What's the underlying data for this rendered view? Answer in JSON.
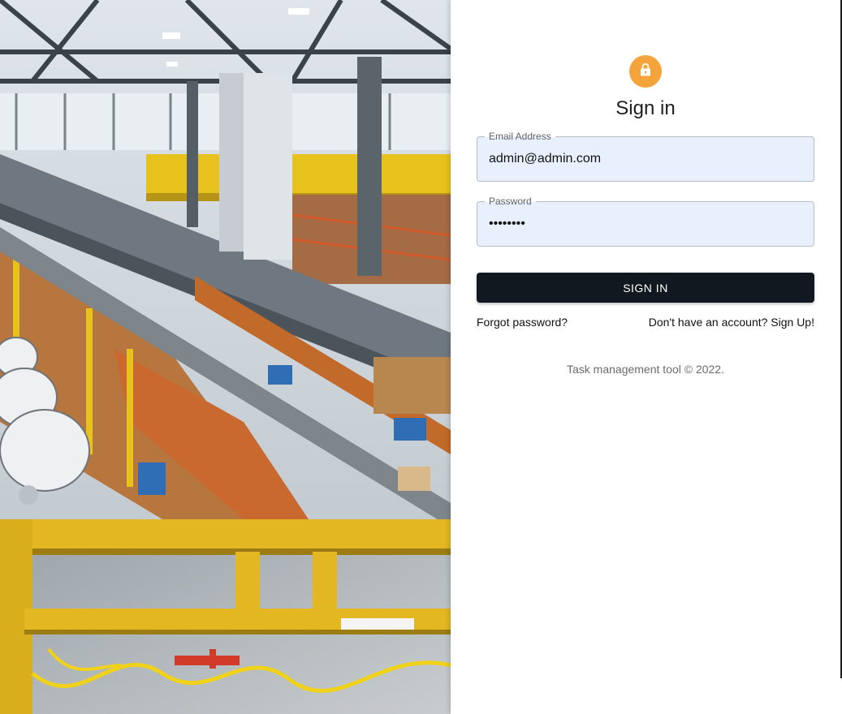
{
  "hero": {
    "image": "warehouse-factory-interior"
  },
  "form": {
    "lock_icon": "lock-icon",
    "title": "Sign in",
    "email": {
      "label": "Email Address",
      "value": "admin@admin.com"
    },
    "password": {
      "label": "Password",
      "value": "••••••••"
    },
    "submit_label": "SIGN IN",
    "forgot_label": "Forgot password?",
    "signup_label": "Don't have an account? Sign Up!",
    "copyright": "Task management tool © 2022."
  },
  "colors": {
    "accent": "#f5a43c",
    "button": "#111820",
    "field_fill": "#e8f0fe"
  }
}
